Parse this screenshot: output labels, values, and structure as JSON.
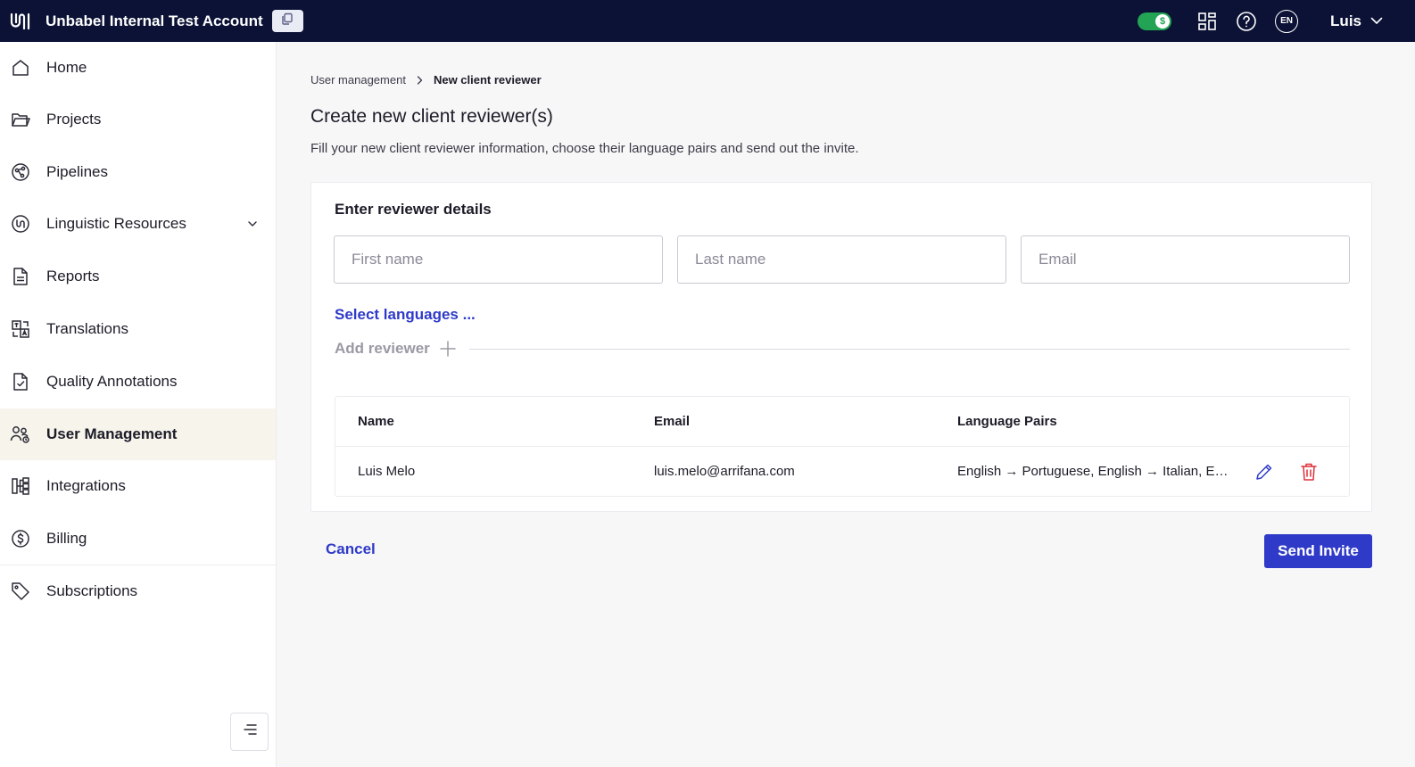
{
  "topbar": {
    "logo_icon": "unbabel-logo-icon",
    "account_name": "Unbabel Internal Test Account",
    "copy_icon": "copy-icon",
    "toggle_icon": "dollar-icon",
    "toggle_glyph": "$",
    "apps_icon": "apps-grid-icon",
    "help_icon": "help-icon",
    "language": "EN",
    "user_name": "Luis",
    "user_menu_icon": "chevron-down-icon"
  },
  "sidebar": {
    "items": [
      {
        "label": "Home",
        "icon": "home-icon"
      },
      {
        "label": "Projects",
        "icon": "folder-icon"
      },
      {
        "label": "Pipelines",
        "icon": "pipelines-icon"
      },
      {
        "label": "Linguistic Resources",
        "icon": "linguistic-resources-icon"
      },
      {
        "label": "Reports",
        "icon": "reports-icon"
      },
      {
        "label": "Translations",
        "icon": "translations-icon"
      },
      {
        "label": "Quality Annotations",
        "icon": "quality-annotations-icon"
      },
      {
        "label": "User Management",
        "icon": "user-management-icon"
      },
      {
        "label": "Integrations",
        "icon": "integrations-icon"
      },
      {
        "label": "Billing",
        "icon": "billing-icon"
      },
      {
        "label": "Subscriptions",
        "icon": "tag-icon"
      }
    ],
    "active": "User Management",
    "collapse_icon": "collapse-menu-icon"
  },
  "breadcrumb": {
    "parent": "User management",
    "current": "New client reviewer"
  },
  "page": {
    "title": "Create new client reviewer(s)",
    "subtitle": "Fill your new client reviewer information, choose their language pairs and send out the invite."
  },
  "form": {
    "title": "Enter reviewer details",
    "first_name_placeholder": "First name",
    "last_name_placeholder": "Last name",
    "email_placeholder": "Email",
    "first_name_value": "",
    "last_name_value": "",
    "email_value": "",
    "select_languages_label": "Select languages ...",
    "add_reviewer_label": "Add reviewer"
  },
  "table": {
    "columns": [
      "Name",
      "Email",
      "Language Pairs"
    ],
    "rows": [
      {
        "name": "Luis Melo",
        "email": "luis.melo@arrifana.com",
        "language_pairs": "English → Portuguese, English → Italian, En..."
      }
    ]
  },
  "actions": {
    "cancel_label": "Cancel",
    "send_label": "Send Invite"
  },
  "colors": {
    "topbar": "#0b1235",
    "accent": "#2f3ac8",
    "toggle": "#23a455",
    "delete": "#e0303a",
    "active_nav": "#f7f4ec"
  }
}
